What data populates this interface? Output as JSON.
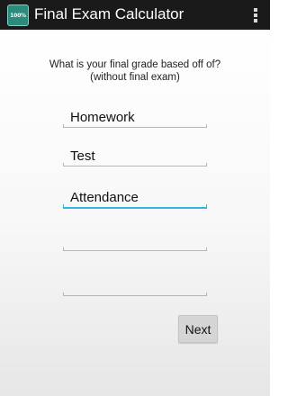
{
  "app": {
    "icon_label": "100%",
    "title": "Final Exam Calculator",
    "overflow_icon": "more-vert-icon"
  },
  "form": {
    "question_line1": "What is your final grade based off of?",
    "question_line2": "(without final exam)",
    "fields": [
      {
        "value": "Homework",
        "placeholder": ""
      },
      {
        "value": "Test",
        "placeholder": ""
      },
      {
        "value": "Attendance",
        "placeholder": ""
      },
      {
        "value": "",
        "placeholder": ""
      },
      {
        "value": "",
        "placeholder": ""
      }
    ],
    "next_label": "Next"
  },
  "colors": {
    "actionbar": "#1a1a1a",
    "focus_accent": "#33b5e5",
    "app_icon": "#2b8c7e"
  }
}
